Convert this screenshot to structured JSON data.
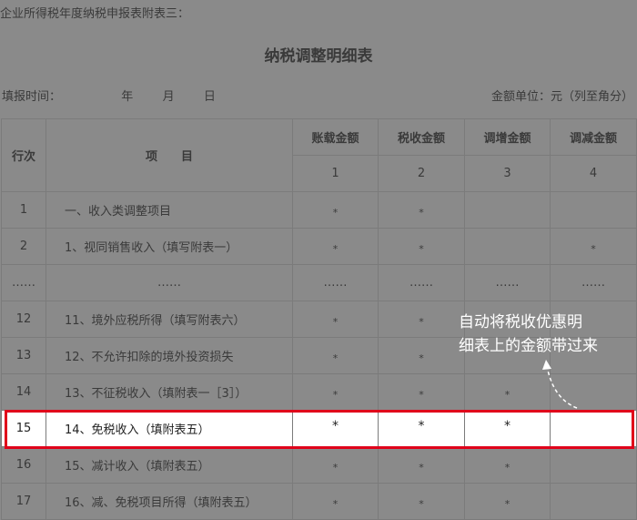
{
  "header": {
    "caption": "企业所得税年度纳税申报表附表三：",
    "title": "纳税调整明细表",
    "fill_date_label": "填报时间：",
    "year": "年",
    "month": "月",
    "day": "日",
    "unit": "金额单位：元（列至角分）"
  },
  "table": {
    "col_row_no": "行次",
    "col_item": "项　　目",
    "columns": [
      "账载金额",
      "税收金额",
      "调增金额",
      "调减金额"
    ],
    "column_numbers": [
      "1",
      "2",
      "3",
      "4"
    ],
    "rows": [
      {
        "no": "1",
        "item": "一、收入类调整项目",
        "c1": "*",
        "c2": "*",
        "c3": "",
        "c4": ""
      },
      {
        "no": "2",
        "item": "1、视同销售收入（填写附表一）",
        "c1": "*",
        "c2": "*",
        "c3": "",
        "c4": "*"
      },
      {
        "no": "……",
        "item": "……",
        "c1": "……",
        "c2": "……",
        "c3": "……",
        "c4": "……"
      },
      {
        "no": "12",
        "item": "11、境外应税所得（填写附表六）",
        "c1": "*",
        "c2": "*",
        "c3": "",
        "c4": ""
      },
      {
        "no": "13",
        "item": "12、不允许扣除的境外投资损失",
        "c1": "*",
        "c2": "*",
        "c3": "",
        "c4": ""
      },
      {
        "no": "14",
        "item": "13、不征税收入（填附表一［3］）",
        "c1": "*",
        "c2": "*",
        "c3": "*",
        "c4": ""
      },
      {
        "no": "15",
        "item": "14、免税收入（填附表五）",
        "c1": "*",
        "c2": "*",
        "c3": "*",
        "c4": ""
      },
      {
        "no": "16",
        "item": "15、减计收入（填附表五）",
        "c1": "*",
        "c2": "*",
        "c3": "*",
        "c4": ""
      },
      {
        "no": "17",
        "item": "16、减、免税项目所得（填附表五）",
        "c1": "*",
        "c2": "*",
        "c3": "*",
        "c4": ""
      }
    ]
  },
  "annotation": {
    "line1": "自动将税收优惠明",
    "line2": "细表上的金额带过来"
  },
  "colors": {
    "highlight_border": "#e0001a",
    "overlay": "#8a8a8a"
  }
}
